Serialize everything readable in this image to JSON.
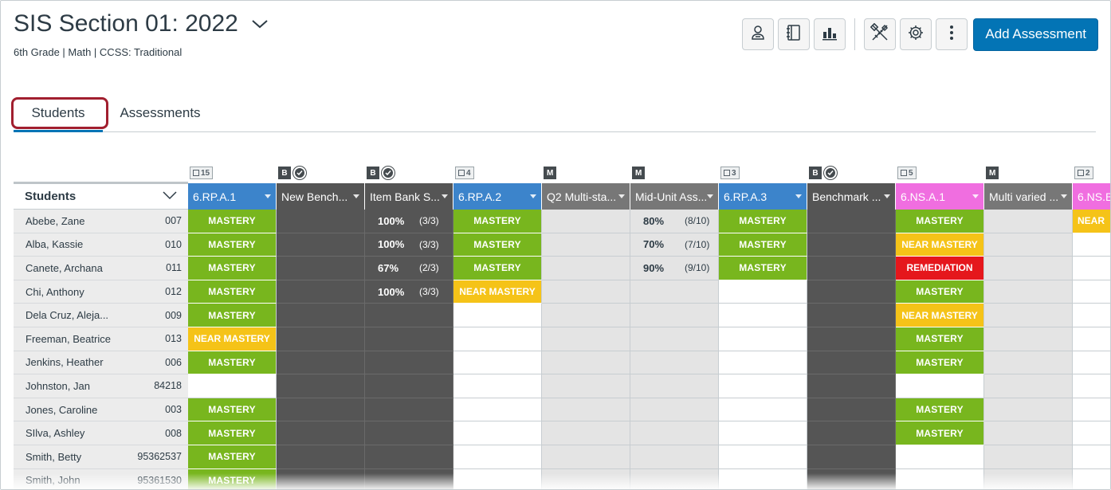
{
  "header": {
    "title": "SIS Section 01: 2022",
    "subtitle": "6th Grade  |  Math  |  CCSS: Traditional"
  },
  "toolbar": {
    "icons": [
      "student-icon",
      "notebook-icon",
      "bar-chart-icon",
      "tools-icon",
      "gear-icon",
      "more-vertical-icon"
    ],
    "add_label": "Add Assessment"
  },
  "tabs": [
    {
      "label": "Students"
    },
    {
      "label": "Assessments"
    }
  ],
  "grid": {
    "students_header": "Students",
    "badges": [
      "15",
      "B",
      "B",
      "4",
      "M",
      "M",
      "3",
      "B",
      "5",
      "M",
      "2"
    ],
    "columns": [
      {
        "label": "6.RP.A.1",
        "color": "#3c84cb"
      },
      {
        "label": "New Bench...",
        "color": "#555555"
      },
      {
        "label": "Item Bank S...",
        "color": "#555555"
      },
      {
        "label": "6.RP.A.2",
        "color": "#3c84cb"
      },
      {
        "label": "Q2 Multi-sta...",
        "color": "#777777"
      },
      {
        "label": "Mid-Unit Ass...",
        "color": "#777777"
      },
      {
        "label": "6.RP.A.3",
        "color": "#3c84cb"
      },
      {
        "label": "Benchmark ...",
        "color": "#555555"
      },
      {
        "label": "6.NS.A.1",
        "color": "#f06ee0"
      },
      {
        "label": "Multi varied ...",
        "color": "#777777"
      },
      {
        "label": "6.NS.B",
        "color": "#f06ee0"
      }
    ],
    "students": [
      {
        "name": "Abebe, Zane",
        "id": "007"
      },
      {
        "name": "Alba, Kassie",
        "id": "010"
      },
      {
        "name": "Canete, Archana",
        "id": "011"
      },
      {
        "name": "Chi, Anthony",
        "id": "012"
      },
      {
        "name": "Dela Cruz, Aleja...",
        "id": "009"
      },
      {
        "name": "Freeman, Beatrice",
        "id": "013"
      },
      {
        "name": "Jenkins, Heather",
        "id": "006"
      },
      {
        "name": "Johnston, Jan",
        "id": "84218"
      },
      {
        "name": "Jones, Caroline",
        "id": "003"
      },
      {
        "name": "SIlva, Ashley",
        "id": "008"
      },
      {
        "name": "Smith, Betty",
        "id": "95362537"
      },
      {
        "name": "Smith, John",
        "id": "95361530"
      }
    ],
    "levels": {
      "mastery": "MASTERY",
      "near": "NEAR MASTERY",
      "remediation": "REMEDIATION",
      "near_cut": "NEAR"
    },
    "cells": [
      [
        "mastery",
        "",
        "100%|(3/3)",
        "mastery",
        "",
        "80%|(8/10)",
        "mastery",
        "",
        "mastery",
        "",
        "near_cut"
      ],
      [
        "mastery",
        "",
        "100%|(3/3)",
        "mastery",
        "",
        "70%|(7/10)",
        "mastery",
        "",
        "near",
        "",
        ""
      ],
      [
        "mastery",
        "",
        "67%|(2/3)",
        "mastery",
        "",
        "90%|(9/10)",
        "mastery",
        "",
        "remediation",
        "",
        ""
      ],
      [
        "mastery",
        "",
        "100%|(3/3)",
        "near",
        "",
        "",
        "",
        "",
        "mastery",
        "",
        ""
      ],
      [
        "mastery",
        "",
        "",
        "",
        "",
        "",
        "",
        "",
        "near",
        "",
        ""
      ],
      [
        "near",
        "",
        "",
        "",
        "",
        "",
        "",
        "",
        "mastery",
        "",
        ""
      ],
      [
        "mastery",
        "",
        "",
        "",
        "",
        "",
        "",
        "",
        "mastery",
        "",
        ""
      ],
      [
        "",
        "",
        "",
        "",
        "",
        "",
        "",
        "",
        "",
        "",
        ""
      ],
      [
        "mastery",
        "",
        "",
        "",
        "",
        "",
        "",
        "",
        "mastery",
        "",
        ""
      ],
      [
        "mastery",
        "",
        "",
        "",
        "",
        "",
        "",
        "",
        "mastery",
        "",
        ""
      ],
      [
        "mastery",
        "",
        "",
        "",
        "",
        "",
        "",
        "",
        "",
        "",
        ""
      ],
      [
        "mastery",
        "",
        "",
        "",
        "",
        "",
        "",
        "",
        "",
        "",
        ""
      ]
    ]
  }
}
